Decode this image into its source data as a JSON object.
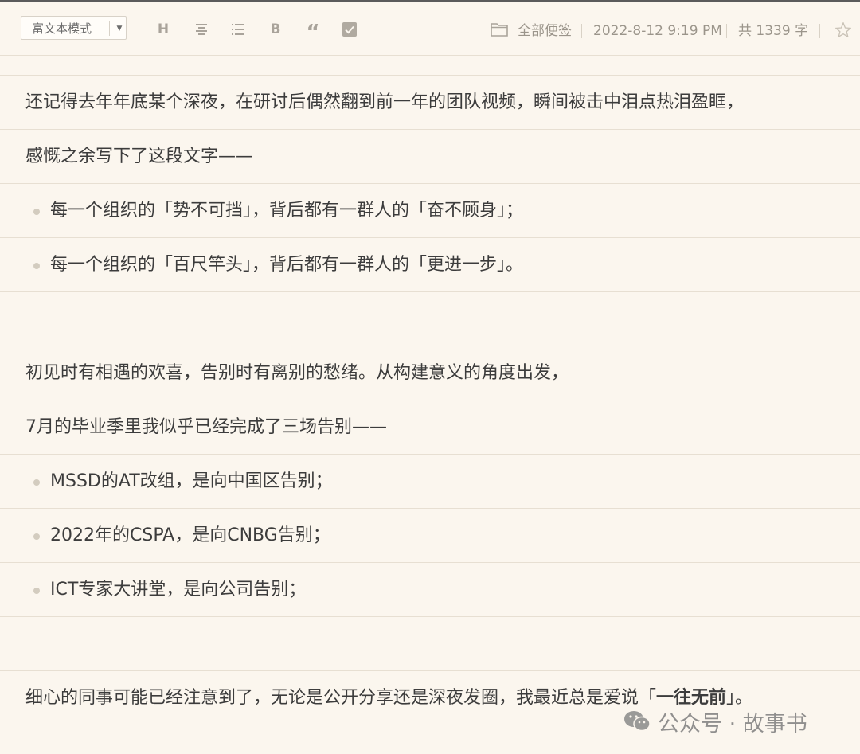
{
  "toolbar": {
    "mode_label": "富文本模式",
    "tools": [
      {
        "icon": "heading-icon",
        "glyph": "H"
      },
      {
        "icon": "align-center-icon"
      },
      {
        "icon": "list-icon"
      },
      {
        "icon": "bold-icon",
        "glyph": "B"
      },
      {
        "icon": "quote-icon",
        "glyph": "“"
      },
      {
        "icon": "checkbox-icon"
      }
    ],
    "folder_label": "全部便签",
    "date": "2022-8-12 9:19 PM",
    "word_count": "共 1339 字"
  },
  "editor": {
    "lines": [
      {
        "type": "para",
        "text": "还记得去年年底某个深夜，在研讨后偶然翻到前一年的团队视频，瞬间被击中泪点热泪盈眶，"
      },
      {
        "type": "para",
        "text": "感慨之余写下了这段文字——"
      },
      {
        "type": "bullet",
        "text": "每一个组织的「势不可挡」，背后都有一群人的「奋不顾身」；"
      },
      {
        "type": "bullet",
        "text": "每一个组织的「百尺竿头」，背后都有一群人的「更进一步」。"
      },
      {
        "type": "empty",
        "text": ""
      },
      {
        "type": "para",
        "text": "初见时有相遇的欢喜，告别时有离别的愁绪。从构建意义的角度出发，"
      },
      {
        "type": "para",
        "text": "7月的毕业季里我似乎已经完成了三场告别——"
      },
      {
        "type": "bullet",
        "text": "MSSD的AT改组，是向中国区告别；"
      },
      {
        "type": "bullet",
        "text": "2022年的CSPA，是向CNBG告别；"
      },
      {
        "type": "bullet",
        "text": "ICT专家大讲堂，是向公司告别；"
      },
      {
        "type": "empty",
        "text": ""
      },
      {
        "type": "para",
        "text_before": "细心的同事可能已经注意到了，无论是公开分享还是深夜发圈，我最近总是爱说「",
        "text_bold": "一往无前",
        "text_after": "」。"
      }
    ]
  },
  "watermark": {
    "text": "公众号 · 故事书"
  },
  "colors": {
    "background": "#fbf6ee",
    "rule": "#e7dfd2",
    "text": "#3c3c3c",
    "muted": "#9b958b"
  }
}
